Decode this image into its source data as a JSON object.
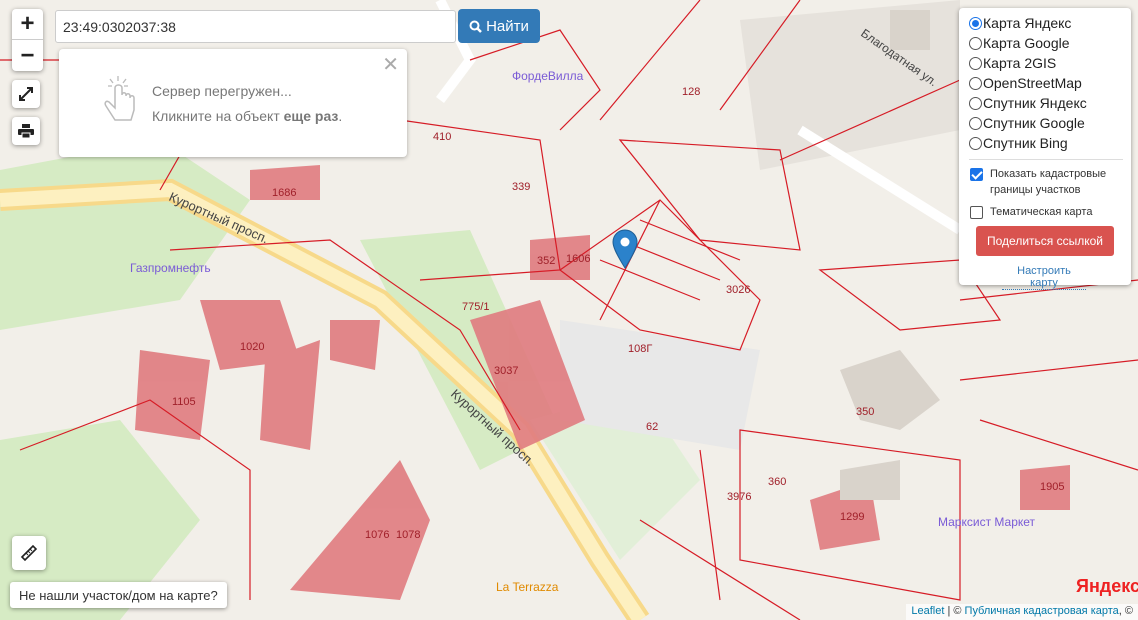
{
  "search": {
    "value": "23:49:0302037:38",
    "button_label": "Найти"
  },
  "zoom": {
    "in": "+",
    "out": "−"
  },
  "popup": {
    "line1": "Сервер перегружен...",
    "line2_prefix": "Кликните на объект ",
    "line2_bold": "еще раз",
    "line2_suffix": "."
  },
  "layers": {
    "options": [
      {
        "label": "Карта Яндекс",
        "selected": true
      },
      {
        "label": "Карта Google",
        "selected": false
      },
      {
        "label": "Карта 2GIS",
        "selected": false
      },
      {
        "label": "OpenStreetMap",
        "selected": false
      },
      {
        "label": "Спутник Яндекс",
        "selected": false
      },
      {
        "label": "Спутник Google",
        "selected": false
      },
      {
        "label": "Спутник Bing",
        "selected": false
      }
    ],
    "show_cadastral_label": "Показать кадастровые границы участков",
    "show_cadastral": true,
    "thematic_label": "Тематическая карта",
    "thematic": false,
    "share_label": "Поделиться ссылкой",
    "tune_label": "Настроить карту"
  },
  "not_found_label": "Не нашли участок/дом на карте?",
  "attribution": {
    "leaflet": "Leaflet",
    "sep": " | © ",
    "pkk": "Публичная кадастровая карта",
    "suffix": ", ©"
  },
  "map_labels": {
    "street1": "Курортный просп.",
    "street2": "Курортный просп.",
    "street3": "Благодатная ул.",
    "poi1": "Газпромнефть",
    "poi2": "ФордеВилла",
    "poi3": "La Terrazza",
    "poi4": "Марксист Маркет",
    "brand": "Яндекс",
    "p1": "410",
    "p2": "339",
    "p3": "352",
    "p4": "1606",
    "p5": "775/1",
    "p6": "3037",
    "p7": "1020",
    "p8": "1105",
    "p9": "1076",
    "p10": "1078",
    "p11": "350",
    "p12": "62",
    "p13": "108Г",
    "p14": "3026",
    "p15": "1299",
    "p16": "1905",
    "p17": "1686",
    "p18": "128",
    "p19": "3976",
    "p20": "360"
  }
}
